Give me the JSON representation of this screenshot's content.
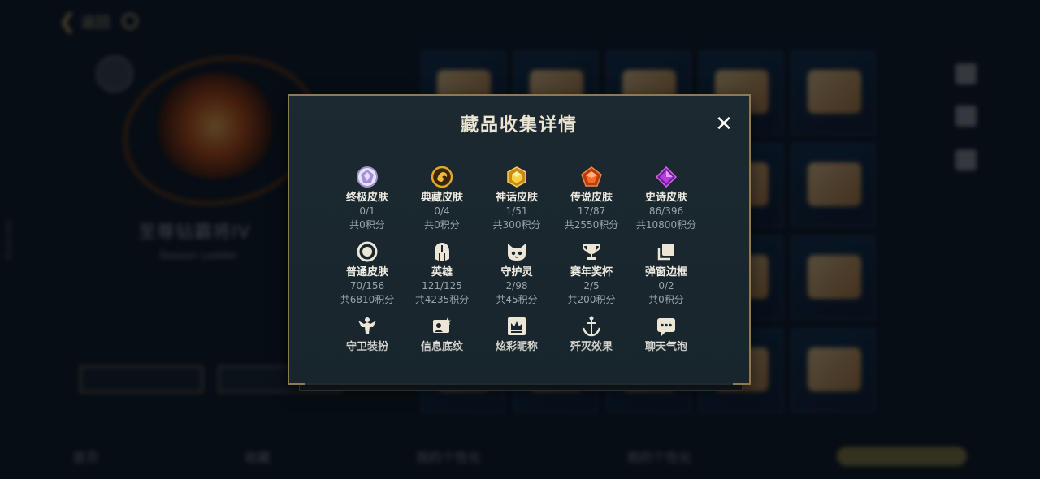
{
  "background": {
    "back_label": "返回",
    "rank_text": "至尊钻霸将IV",
    "rank_sub": "Season Ladder",
    "side_id": "18074536",
    "bottom_tabs": [
      "首页",
      "收藏",
      "我的个性化",
      "我的个性化"
    ]
  },
  "modal": {
    "title": "藏品收集详情",
    "close_label": "✕",
    "categories": [
      {
        "icon": "ultimate-skin-gem-icon",
        "name": "终极皮肤",
        "count": "0/1",
        "points": "共0积分"
      },
      {
        "icon": "classic-skin-dragon-icon",
        "name": "典藏皮肤",
        "count": "0/4",
        "points": "共0积分"
      },
      {
        "icon": "myth-skin-gem-icon",
        "name": "神话皮肤",
        "count": "1/51",
        "points": "共300积分"
      },
      {
        "icon": "legend-skin-gem-icon",
        "name": "传说皮肤",
        "count": "17/87",
        "points": "共2550积分"
      },
      {
        "icon": "epic-skin-gem-icon",
        "name": "史诗皮肤",
        "count": "86/396",
        "points": "共10800积分"
      },
      {
        "icon": "normal-skin-ring-icon",
        "name": "普通皮肤",
        "count": "70/156",
        "points": "共6810积分"
      },
      {
        "icon": "hero-helmet-icon",
        "name": "英雄",
        "count": "121/125",
        "points": "共4235积分"
      },
      {
        "icon": "guardian-spirit-icon",
        "name": "守护灵",
        "count": "2/98",
        "points": "共45积分"
      },
      {
        "icon": "trophy-icon",
        "name": "赛年奖杯",
        "count": "2/5",
        "points": "共200积分"
      },
      {
        "icon": "popup-frame-icon",
        "name": "弹窗边框",
        "count": "0/2",
        "points": "共0积分"
      },
      {
        "icon": "guard-outfit-icon",
        "name": "守卫装扮",
        "count": "",
        "points": ""
      },
      {
        "icon": "info-background-icon",
        "name": "信息底纹",
        "count": "",
        "points": ""
      },
      {
        "icon": "colorful-nickname-icon",
        "name": "炫彩昵称",
        "count": "",
        "points": ""
      },
      {
        "icon": "annihilation-effect-icon",
        "name": "歼灭效果",
        "count": "",
        "points": ""
      },
      {
        "icon": "chat-bubble-icon",
        "name": "聊天气泡",
        "count": "",
        "points": ""
      }
    ]
  }
}
